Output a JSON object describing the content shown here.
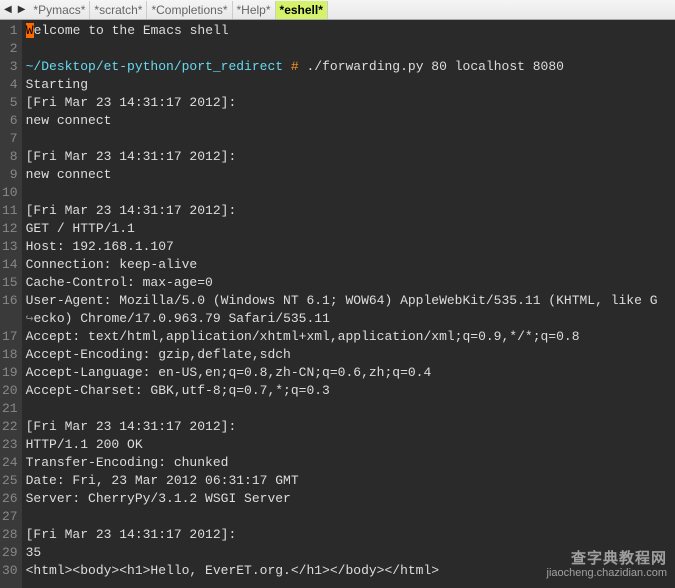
{
  "toolbar": {
    "arrows": {
      "left": "◀",
      "right": "▶"
    },
    "tabs": [
      {
        "label": "*Pymacs*",
        "active": false
      },
      {
        "label": "*scratch*",
        "active": false
      },
      {
        "label": "*Completions*",
        "active": false
      },
      {
        "label": "*Help*",
        "active": false
      },
      {
        "label": "*eshell*",
        "active": true
      }
    ]
  },
  "editor": {
    "lines": [
      {
        "n": "1",
        "segs": [
          {
            "t": "W",
            "cls": "cursor"
          },
          {
            "t": "elcome to the Emacs shell"
          }
        ]
      },
      {
        "n": "2",
        "segs": [
          {
            "t": ""
          }
        ]
      },
      {
        "n": "3",
        "segs": [
          {
            "t": "~/Desktop/et-python/port_redirect",
            "cls": "cyan"
          },
          {
            "t": " "
          },
          {
            "t": "#",
            "cls": "orange"
          },
          {
            "t": " ./forwarding.py 80 localhost 8080"
          }
        ]
      },
      {
        "n": "4",
        "segs": [
          {
            "t": "Starting"
          }
        ]
      },
      {
        "n": "5",
        "segs": [
          {
            "t": "[Fri Mar 23 14:31:17 2012]:"
          }
        ]
      },
      {
        "n": "6",
        "segs": [
          {
            "t": "new connect"
          }
        ]
      },
      {
        "n": "7",
        "segs": [
          {
            "t": ""
          }
        ]
      },
      {
        "n": "8",
        "segs": [
          {
            "t": "[Fri Mar 23 14:31:17 2012]:"
          }
        ]
      },
      {
        "n": "9",
        "segs": [
          {
            "t": "new connect"
          }
        ]
      },
      {
        "n": "10",
        "segs": [
          {
            "t": ""
          }
        ]
      },
      {
        "n": "11",
        "segs": [
          {
            "t": "[Fri Mar 23 14:31:17 2012]:"
          }
        ]
      },
      {
        "n": "12",
        "segs": [
          {
            "t": "GET / HTTP/1.1"
          }
        ]
      },
      {
        "n": "13",
        "segs": [
          {
            "t": "Host: 192.168.1.107"
          }
        ]
      },
      {
        "n": "14",
        "segs": [
          {
            "t": "Connection: keep-alive"
          }
        ]
      },
      {
        "n": "15",
        "segs": [
          {
            "t": "Cache-Control: max-age=0"
          }
        ]
      },
      {
        "n": "16",
        "segs": [
          {
            "t": "User-Agent: Mozilla/5.0 (Windows NT 6.1; WOW64) AppleWebKit/535.11 (KHTML, like G"
          }
        ]
      },
      {
        "n": "",
        "segs": [
          {
            "t": "↪",
            "cls": "wrap"
          },
          {
            "t": "ecko) Chrome/17.0.963.79 Safari/535.11"
          }
        ]
      },
      {
        "n": "17",
        "segs": [
          {
            "t": "Accept: text/html,application/xhtml+xml,application/xml;q=0.9,*/*;q=0.8"
          }
        ]
      },
      {
        "n": "18",
        "segs": [
          {
            "t": "Accept-Encoding: gzip,deflate,sdch"
          }
        ]
      },
      {
        "n": "19",
        "segs": [
          {
            "t": "Accept-Language: en-US,en;q=0.8,zh-CN;q=0.6,zh;q=0.4"
          }
        ]
      },
      {
        "n": "20",
        "segs": [
          {
            "t": "Accept-Charset: GBK,utf-8;q=0.7,*;q=0.3"
          }
        ]
      },
      {
        "n": "21",
        "segs": [
          {
            "t": ""
          }
        ]
      },
      {
        "n": "22",
        "segs": [
          {
            "t": "[Fri Mar 23 14:31:17 2012]:"
          }
        ]
      },
      {
        "n": "23",
        "segs": [
          {
            "t": "HTTP/1.1 200 OK"
          }
        ]
      },
      {
        "n": "24",
        "segs": [
          {
            "t": "Transfer-Encoding: chunked"
          }
        ]
      },
      {
        "n": "25",
        "segs": [
          {
            "t": "Date: Fri, 23 Mar 2012 06:31:17 GMT"
          }
        ]
      },
      {
        "n": "26",
        "segs": [
          {
            "t": "Server: CherryPy/3.1.2 WSGI Server"
          }
        ]
      },
      {
        "n": "27",
        "segs": [
          {
            "t": ""
          }
        ]
      },
      {
        "n": "28",
        "segs": [
          {
            "t": "[Fri Mar 23 14:31:17 2012]:"
          }
        ]
      },
      {
        "n": "29",
        "segs": [
          {
            "t": "35"
          }
        ]
      },
      {
        "n": "30",
        "segs": [
          {
            "t": "<html><body><h1>Hello, EverET.org.</h1></body></html>"
          }
        ]
      }
    ]
  },
  "watermark": {
    "line1": "查字典教程网",
    "line2": "jiaocheng.chazidian.com"
  }
}
